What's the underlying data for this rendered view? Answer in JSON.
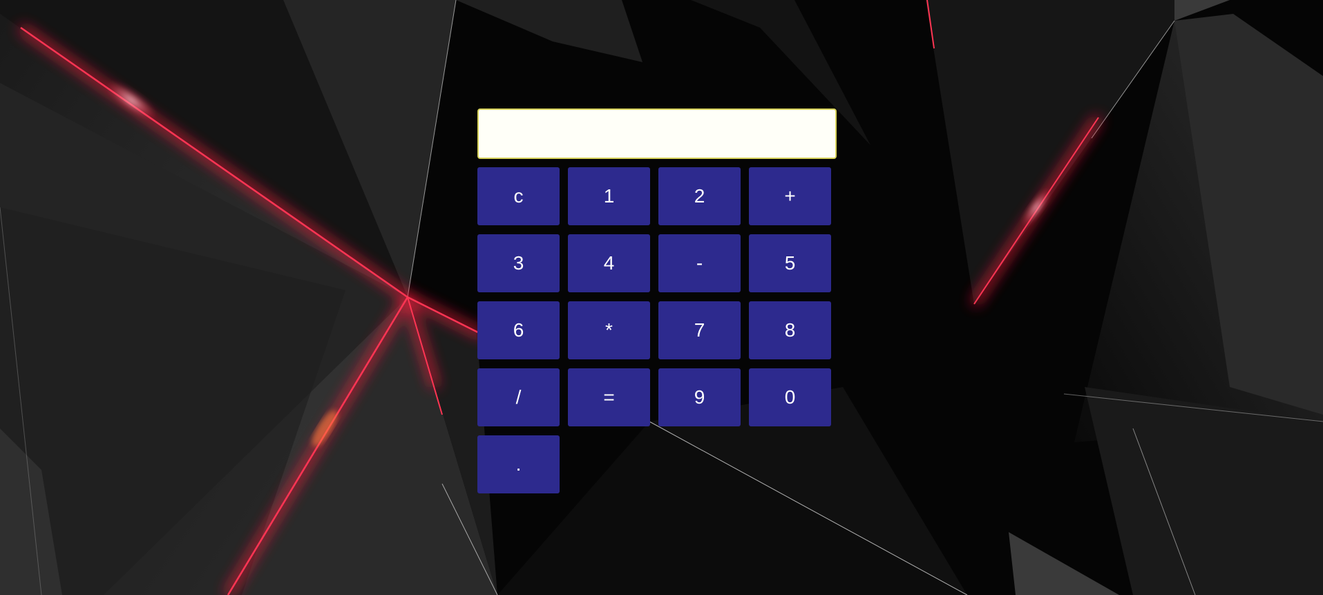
{
  "display": {
    "value": "",
    "placeholder": ""
  },
  "keypad": {
    "keys": [
      "c",
      "1",
      "2",
      "+",
      "3",
      "4",
      "-",
      "5",
      "6",
      "*",
      "7",
      "8",
      "/",
      "=",
      "9",
      "0",
      "."
    ]
  },
  "colors": {
    "background": "#050505",
    "key_fill": "#2d2a8e",
    "key_text": "#ffffff",
    "display_fill": "#fffff8",
    "display_border": "#d8d35a",
    "accent_glow": "#ff1a3c"
  }
}
